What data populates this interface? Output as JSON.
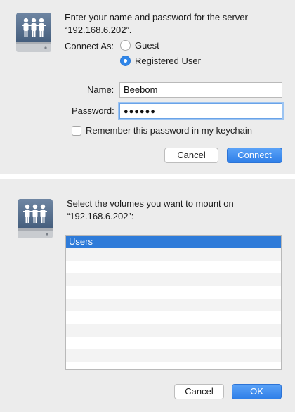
{
  "connect_dialog": {
    "icon": "server-share-icon",
    "prompt_line1": "Enter your name and password for the server",
    "prompt_line2": "“192.168.6.202”.",
    "connect_as_label": "Connect As:",
    "options": [
      {
        "label": "Guest",
        "selected": false
      },
      {
        "label": "Registered User",
        "selected": true
      }
    ],
    "name_label": "Name:",
    "name_value": "Beebom",
    "password_label": "Password:",
    "password_value": "●●●●●●",
    "remember_label": "Remember this password in my keychain",
    "remember_checked": false,
    "cancel_label": "Cancel",
    "connect_label": "Connect"
  },
  "volumes_dialog": {
    "icon": "server-share-icon",
    "prompt_line1": "Select the volumes you want to mount on",
    "prompt_line2": "“192.168.6.202”:",
    "volumes": [
      {
        "name": "Users",
        "selected": true
      }
    ],
    "cancel_label": "Cancel",
    "ok_label": "OK"
  },
  "colors": {
    "accent": "#2f7fe8",
    "dialog_bg": "#ececec",
    "selection": "#2e7bd9"
  }
}
